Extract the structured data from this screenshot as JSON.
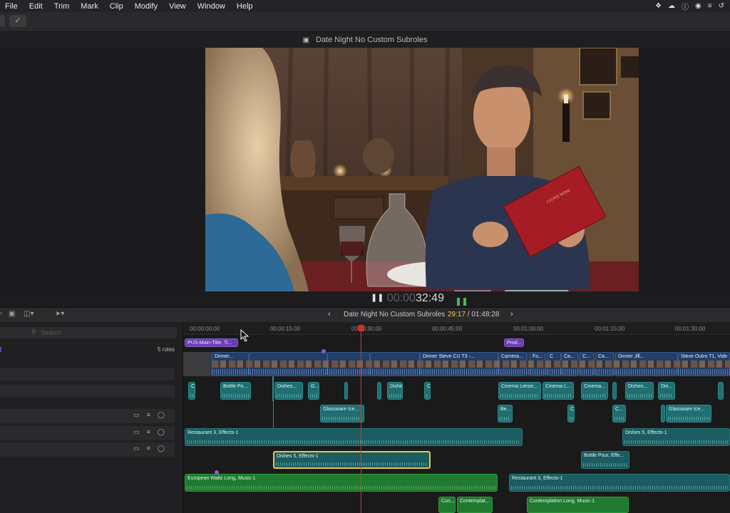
{
  "menubar": {
    "items": [
      "File",
      "Edit",
      "Trim",
      "Mark",
      "Clip",
      "Modify",
      "View",
      "Window",
      "Help"
    ]
  },
  "status_icons": [
    "dropbox-icon",
    "cloud-icon",
    "info-icon",
    "user-icon",
    "wifi-icon",
    "time-machine-icon"
  ],
  "viewer": {
    "title": "Date Night No Custom Subroles",
    "book_text": "I LOVE WINE",
    "timecode_dim": "00:00",
    "timecode_bright": "32:49"
  },
  "timeline_header": {
    "project_name": "Date Night No Custom Subroles",
    "position": "29:17",
    "separator": " / ",
    "duration": "01:48:28",
    "back_icon": "chevron-left-icon",
    "forward_icon": "chevron-right-icon"
  },
  "index": {
    "search_placeholder": "Search",
    "roles_count": "5 roles"
  },
  "ruler": {
    "ticks": [
      "00:00:00:00",
      "00:00:15:00",
      "00:00:30:00",
      "00:00:45:00",
      "00:01:00:00",
      "00:01:15:00",
      "00:01:30:00"
    ]
  },
  "clips": {
    "title1": "PUS-Main-Title, Ti...",
    "title2": "Prod...",
    "primary": [
      "Dinner...",
      "Dinner Steve CU T3 -...",
      "Camera...",
      "Fo...",
      "C",
      "Ca...",
      "C...",
      "Ca...",
      "Dinner Jill...",
      "Steve Outro T1, Vide"
    ],
    "conn_row1": [
      "C",
      "Bottle Po...",
      "Dishes...",
      "G...",
      "Dishes...",
      "C",
      "Cinema Lense...",
      "Cinema L...",
      "Cinema...",
      "Dishes...",
      "Din..."
    ],
    "conn_row2": [
      "Glassware Ice...",
      "Be...",
      "C",
      "C...",
      "Glassware Ice..."
    ],
    "restaurant1": "Restaurant 3, Effects-1",
    "dishes_right": "Dishes 5, Effects-1",
    "dishes_selected": "Dishes 5, Effects-1",
    "bottle_pour": "Bottle Pour, Effe...",
    "music1": "European Waltz Long, Music-1",
    "restaurant2": "Restaurant 3, Effects-1",
    "con1": "Con...",
    "contemplat": "Contemplat...",
    "contemplation": "Contemplation Long, Music-1"
  },
  "colors": {
    "audio_teal": "#1f6f72",
    "music_green": "#1f7a2f",
    "title_purple": "#6a3fb0",
    "playhead_red": "#d33333",
    "selection_yellow": "#e6c84a",
    "timecode_yellow": "#e8c64a"
  }
}
